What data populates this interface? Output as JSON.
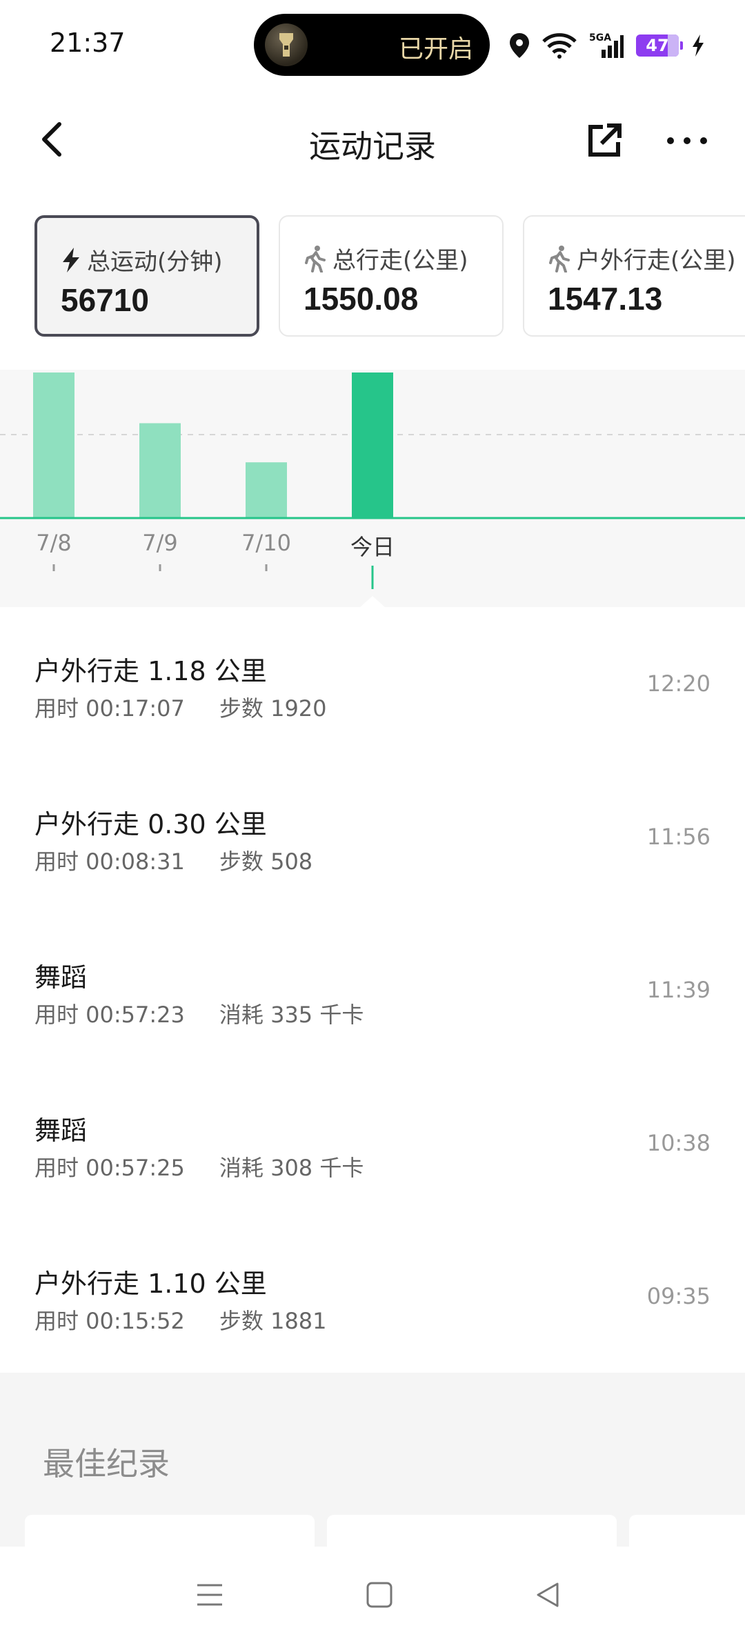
{
  "status_bar": {
    "time": "21:37",
    "island_text": "已开启",
    "network": "5G",
    "battery": "47",
    "icons": [
      "flashlight-icon",
      "location-icon",
      "wifi-icon",
      "signal-icon",
      "battery-icon",
      "charging-icon"
    ]
  },
  "header": {
    "title": "运动记录",
    "icons": [
      "back-icon",
      "share-icon",
      "more-icon"
    ]
  },
  "cards": [
    {
      "label": "总运动(分钟)",
      "value": "56710",
      "icon": "lightning-icon",
      "selected": true
    },
    {
      "label": "总行走(公里)",
      "value": "1550.08",
      "icon": "walk-icon",
      "selected": false
    },
    {
      "label": "户外行走(公里)",
      "value": "1547.13",
      "icon": "walk-icon",
      "selected": false
    }
  ],
  "chart_data": {
    "type": "bar",
    "categories": [
      "7/8",
      "7/9",
      "7/10",
      "今日"
    ],
    "values": [
      1.0,
      0.65,
      0.38,
      1.0
    ],
    "highlighted": "今日",
    "colors": {
      "bar": "#8fe0bf",
      "highlight": "#26c58a"
    }
  },
  "workouts": [
    {
      "title": "户外行走 1.18 公里",
      "duration": "用时 00:17:07",
      "metric": "步数 1920",
      "time": "12:20"
    },
    {
      "title": "户外行走 0.30 公里",
      "duration": "用时 00:08:31",
      "metric": "步数 508",
      "time": "11:56"
    },
    {
      "title": "舞蹈",
      "duration": "用时 00:57:23",
      "metric": "消耗 335 千卡",
      "time": "11:39"
    },
    {
      "title": "舞蹈",
      "duration": "用时 00:57:25",
      "metric": "消耗 308 千卡",
      "time": "10:38"
    },
    {
      "title": "户外行走 1.10 公里",
      "duration": "用时 00:15:52",
      "metric": "步数 1881",
      "time": "09:35"
    }
  ],
  "best_records": {
    "title": "最佳纪录"
  },
  "nav": {
    "icons": [
      "menu-icon",
      "home-icon",
      "back-triangle-icon"
    ]
  }
}
